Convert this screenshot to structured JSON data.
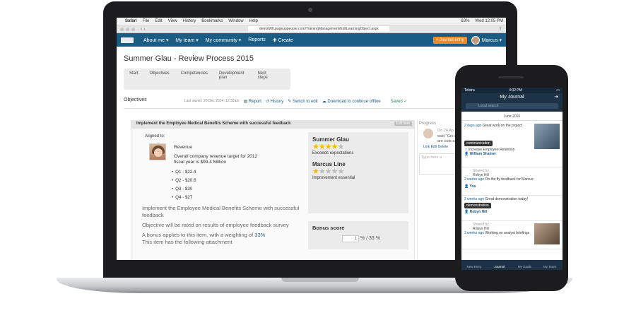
{
  "mac_menu": {
    "apple": "",
    "items": [
      "Safari",
      "File",
      "Edit",
      "View",
      "History",
      "Bookmarks",
      "Window",
      "Help"
    ],
    "battery": "63%",
    "clock": "Wed 12:05 PM"
  },
  "browser": {
    "url": "demo600.pageuppeople.com/TrainingManagement/EditLearningObject.aspx"
  },
  "nav": {
    "items": [
      "About me ▾",
      "My team ▾",
      "My community ▾",
      "Reports",
      "✚ Create"
    ],
    "journal_button": "+ Journal entry",
    "user": "Marcus ▾"
  },
  "page": {
    "title": "Summer Glau - Review Process 2015",
    "steps": [
      "Start",
      "Objectives",
      "Competencies",
      "Development plan",
      "Next steps"
    ],
    "section": "Objectives"
  },
  "toolbar": {
    "last_saved": "Last saved: 20 Dec 2014, 12:32am",
    "report": "Report",
    "history": "History",
    "switch": "Switch to edit",
    "download": "Download to continue offline",
    "saved": "Saved ✓"
  },
  "objective": {
    "title": "Implement the Employee Medical Benefits Scheme with successful feedback",
    "edit": "Edit item",
    "aligned": "Aligned to:",
    "revenue_title": "Revenue",
    "revenue_text": "Overall company revenue target for 2012 fiscal year is $99.4 Million",
    "quarters": [
      "Q1 - $22.4",
      "Q2 - $20.6",
      "Q3 - $30",
      "Q4 - $27"
    ],
    "desc1": "Implement the Employee Medical Benefits Scheme with successful feedback",
    "desc2": "Objective will be rated on results of employee feedback survey",
    "desc3": "A bonus applies to this item, with a weighting of",
    "weighting": "33%",
    "desc4": "This item has the following attachment"
  },
  "ratings": [
    {
      "name": "Summer Glau",
      "stars": 4,
      "label": "Exceeds expectations"
    },
    {
      "name": "Marcus Line",
      "stars": 1,
      "label": "Improvement essential"
    }
  ],
  "bonus": {
    "title": "Bonus score",
    "value": "1",
    "suffix": "% / 33 %"
  },
  "progress": {
    "title": "Progress",
    "date": "On 24 Ap",
    "text": "said \"Gre results are outs always!\"",
    "links": [
      "Link",
      "Edit",
      "Delete"
    ],
    "comment_placeholder": "Type here a"
  },
  "phone": {
    "carrier": "Telstra",
    "time": "4:02 PM",
    "title": "My Journal",
    "search": "Local search",
    "month": "June 2016",
    "entries": [
      {
        "time": "2 days ago",
        "text": "Great work on the project",
        "tag": "communication",
        "sub": "Increase Employee Retention",
        "person": "William Shatner"
      },
      {
        "shared": "Shared by",
        "by": "Robyn Hill",
        "time": "2 weeks ago",
        "text": "On the fly feedback for Marcus",
        "person": "You"
      },
      {
        "time": "2 weeks ago",
        "text": "Great demonstration today!",
        "tag": "demonstration",
        "person": "Robyn Hill"
      },
      {
        "shared": "Shared by",
        "by": "Robyn Hill",
        "time": "3 weeks ago",
        "text": "Working on analyst briefings"
      }
    ],
    "tabs": [
      "New Entry",
      "Journal",
      "My Goals",
      "My Team"
    ]
  }
}
